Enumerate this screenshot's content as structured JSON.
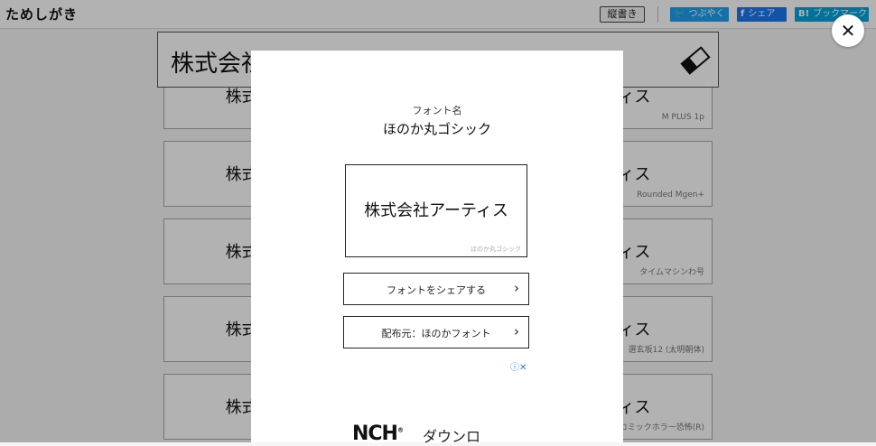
{
  "header": {
    "logo": "ためしがき",
    "vertical_label": "縦書き",
    "tweet_label": "つぶやく",
    "share_label": "シェア",
    "fb_icon": "f",
    "bookmark_label": "ブックマーク",
    "bookmark_icon": "B!"
  },
  "search": {
    "value": "株式会社アーティス"
  },
  "cards": [
    {
      "sample": "株式会社アーティス",
      "font": ""
    },
    {
      "sample": "株式会社アーティス",
      "font": "M PLUS 1p"
    },
    {
      "sample": "株式会社アーティス",
      "font": ""
    },
    {
      "sample": "株式会社アーティス",
      "font": "Rounded Mgen+"
    },
    {
      "sample": "株式会社アーティス",
      "font": ""
    },
    {
      "sample": "株式会社アーティス",
      "font": "タイムマシンわ号"
    },
    {
      "sample": "株式会社アーティス",
      "font": ""
    },
    {
      "sample": "株式会社アーティス",
      "font": "選玄坂12 (太明朝体)"
    },
    {
      "sample": "株式会社アーティス",
      "font": ""
    },
    {
      "sample": "株式会社アーティス",
      "font": "コミックホラー恐怖(R)"
    }
  ],
  "modal": {
    "font_label": "フォント名",
    "font_name": "ほのか丸ゴシック",
    "preview_text": "株式会社アーティス",
    "preview_caption": "ほのか丸ゴシック",
    "share_button": "フォントをシェアする",
    "distributor_button": "配布元：ほのかフォント",
    "chevron": "›",
    "ad_choices": "ⓘ✕",
    "ad_logo": "NCH",
    "ad_logo_mark": "®",
    "ad_text": "ダウンロ"
  },
  "close_glyph": "✕",
  "colors": {
    "twitter": "#1da1f2",
    "facebook": "#1877f2",
    "hatena": "#00a4de"
  }
}
